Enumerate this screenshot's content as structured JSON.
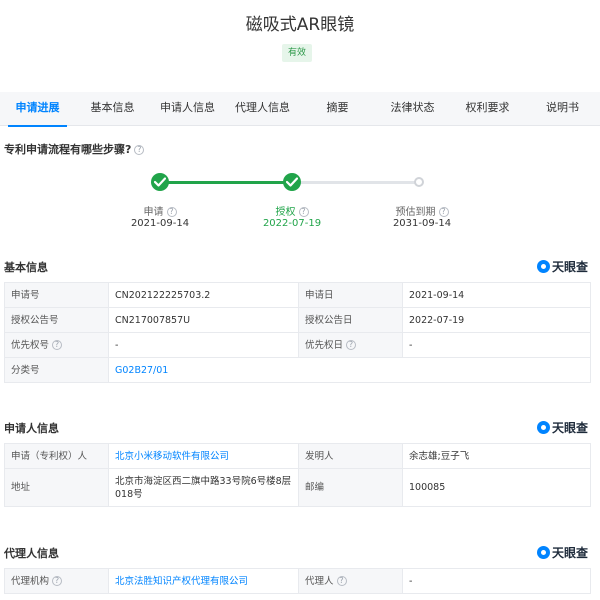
{
  "title": "磁吸式AR眼镜",
  "status_badge": "有效",
  "tabs": [
    "申请进展",
    "基本信息",
    "申请人信息",
    "代理人信息",
    "摘要",
    "法律状态",
    "权利要求",
    "说明书"
  ],
  "progress": {
    "question": "专利申请流程有哪些步骤?",
    "steps": [
      {
        "label": "申请",
        "date": "2021-09-14",
        "status": "done"
      },
      {
        "label": "授权",
        "date": "2022-07-19",
        "status": "done"
      },
      {
        "label": "预估到期",
        "date": "2031-09-14",
        "status": "pending"
      }
    ]
  },
  "brand": "天眼查",
  "help_mark": "?",
  "basic_info": {
    "title": "基本信息",
    "app_no_label": "申请号",
    "app_no": "CN202122225703.2",
    "app_date_label": "申请日",
    "app_date": "2021-09-14",
    "pub_no_label": "授权公告号",
    "pub_no": "CN217007857U",
    "pub_date_label": "授权公告日",
    "pub_date": "2022-07-19",
    "priority_no_label": "优先权号",
    "priority_no": "-",
    "priority_date_label": "优先权日",
    "priority_date": "-",
    "class_label": "分类号",
    "class_no": "G02B27/01"
  },
  "applicant_info": {
    "title": "申请人信息",
    "applicant_label": "申请（专利权）人",
    "applicant": "北京小米移动软件有限公司",
    "inventor_label": "发明人",
    "inventor": "余志雄;豆子飞",
    "address_label": "地址",
    "address": "北京市海淀区西二旗中路33号院6号楼8层018号",
    "postcode_label": "邮编",
    "postcode": "100085"
  },
  "agent_info": {
    "title": "代理人信息",
    "agency_label": "代理机构",
    "agency": "北京法胜知识产权代理有限公司",
    "agent_label": "代理人",
    "agent": "-"
  },
  "colors": {
    "accent": "#0084ff",
    "success": "#21a44a"
  }
}
